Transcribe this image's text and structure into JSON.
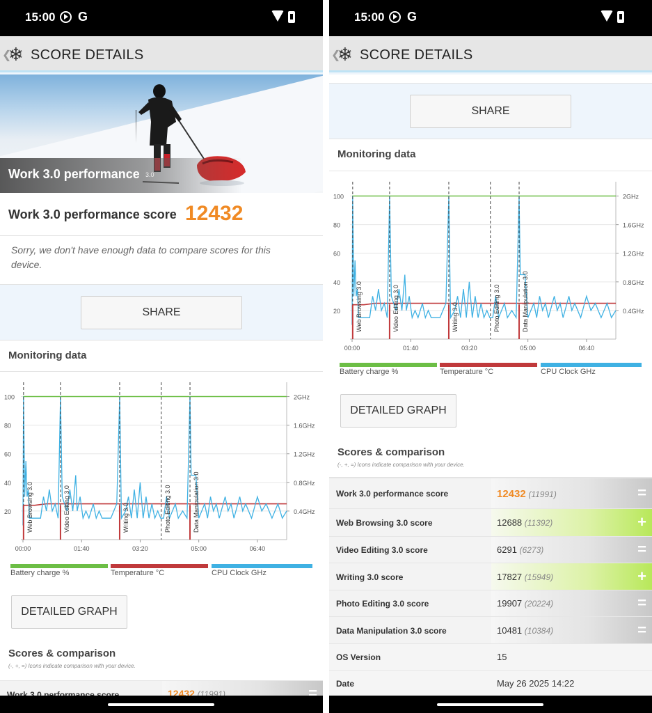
{
  "status": {
    "time": "15:00",
    "carrier_icon": "G"
  },
  "appbar": {
    "title": "SCORE DETAILS",
    "back_icon": "back-chevron",
    "logo_icon": "snowflake"
  },
  "hero": {
    "title": "Work 3.0 performance",
    "version": "3.0"
  },
  "score": {
    "label": "Work 3.0 performance score",
    "value": "12432"
  },
  "compare_note": "Sorry, we don't have enough data to compare scores for this device.",
  "share_label": "SHARE",
  "monitoring": {
    "title": "Monitoring data",
    "detailed_graph_label": "DETAILED GRAPH",
    "legend": [
      {
        "label": "Battery charge %",
        "color": "#6cbe45"
      },
      {
        "label": "Temperature °C",
        "color": "#c0393b"
      },
      {
        "label": "CPU Clock GHz",
        "color": "#3fb1e3"
      }
    ]
  },
  "chart_data": {
    "type": "line",
    "x_ticks": [
      "00:00",
      "01:40",
      "03:20",
      "05:00",
      "06:40"
    ],
    "y_left_ticks": [
      "100",
      "80",
      "60",
      "40",
      "20"
    ],
    "y_right_ticks": [
      "2GHz",
      "1.6GHz",
      "1.2GHz",
      "0.8GHz",
      "0.4GHz"
    ],
    "segments": [
      "Web Browsing 3.0",
      "Video Editing 3.0",
      "Writing 3.0",
      "Photo Editing 3.0",
      "Data Manipulation 3.0"
    ],
    "segment_starts_s": [
      2,
      128,
      330,
      472,
      570
    ],
    "x_max_s": 900,
    "ylim": [
      0,
      110
    ],
    "series": [
      {
        "name": "Battery charge %",
        "color": "#6cbe45",
        "points": [
          [
            0,
            100
          ],
          [
            900,
            100
          ]
        ]
      },
      {
        "name": "Temperature °C",
        "color": "#c0393b",
        "points": [
          [
            0,
            24
          ],
          [
            40,
            24
          ],
          [
            80,
            25
          ],
          [
            900,
            25
          ]
        ]
      },
      {
        "name": "CPU Clock GHz",
        "color": "#3fb1e3",
        "points": [
          [
            0,
            0.2
          ],
          [
            2,
            2.0
          ],
          [
            6,
            0.6
          ],
          [
            10,
            1.1
          ],
          [
            14,
            0.6
          ],
          [
            18,
            0.7
          ],
          [
            22,
            0.3
          ],
          [
            40,
            0.3
          ],
          [
            60,
            0.3
          ],
          [
            70,
            0.6
          ],
          [
            80,
            0.4
          ],
          [
            90,
            0.7
          ],
          [
            100,
            0.4
          ],
          [
            110,
            0.5
          ],
          [
            120,
            0.3
          ],
          [
            128,
            2.0
          ],
          [
            134,
            0.6
          ],
          [
            150,
            0.4
          ],
          [
            160,
            0.7
          ],
          [
            170,
            0.4
          ],
          [
            180,
            0.9
          ],
          [
            185,
            0.4
          ],
          [
            195,
            0.6
          ],
          [
            205,
            0.3
          ],
          [
            215,
            0.4
          ],
          [
            225,
            0.3
          ],
          [
            240,
            0.5
          ],
          [
            250,
            0.3
          ],
          [
            260,
            0.4
          ],
          [
            270,
            0.3
          ],
          [
            300,
            0.3
          ],
          [
            310,
            0.4
          ],
          [
            320,
            0.5
          ],
          [
            330,
            2.0
          ],
          [
            336,
            0.3
          ],
          [
            350,
            0.4
          ],
          [
            360,
            0.6
          ],
          [
            370,
            0.3
          ],
          [
            380,
            0.7
          ],
          [
            390,
            0.3
          ],
          [
            400,
            0.8
          ],
          [
            410,
            0.3
          ],
          [
            420,
            0.6
          ],
          [
            430,
            0.3
          ],
          [
            440,
            0.5
          ],
          [
            450,
            0.3
          ],
          [
            460,
            0.4
          ],
          [
            470,
            0.3
          ],
          [
            480,
            0.3
          ],
          [
            490,
            0.6
          ],
          [
            500,
            0.3
          ],
          [
            510,
            0.4
          ],
          [
            520,
            0.5
          ],
          [
            530,
            0.3
          ],
          [
            545,
            0.4
          ],
          [
            560,
            0.3
          ],
          [
            570,
            2.0
          ],
          [
            574,
            0.9
          ],
          [
            590,
            0.9
          ],
          [
            600,
            0.3
          ],
          [
            620,
            0.5
          ],
          [
            630,
            0.3
          ],
          [
            640,
            0.6
          ],
          [
            650,
            0.4
          ],
          [
            660,
            0.5
          ],
          [
            670,
            0.3
          ],
          [
            690,
            0.6
          ],
          [
            700,
            0.4
          ],
          [
            710,
            0.5
          ],
          [
            720,
            0.3
          ],
          [
            740,
            0.6
          ],
          [
            750,
            0.4
          ],
          [
            760,
            0.5
          ],
          [
            780,
            0.3
          ],
          [
            800,
            0.6
          ],
          [
            815,
            0.4
          ],
          [
            830,
            0.5
          ],
          [
            850,
            0.3
          ],
          [
            870,
            0.5
          ],
          [
            885,
            0.3
          ],
          [
            900,
            0.4
          ]
        ]
      }
    ]
  },
  "scores": {
    "title": "Scores & comparison",
    "note": "(-, +, =) Icons indicate comparison with your device.",
    "rows": [
      {
        "label": "Work 3.0 performance score",
        "value": "12432",
        "compare": "(11991)",
        "symbol": "=",
        "highlight": "grey",
        "accent": true
      },
      {
        "label": "Web Browsing 3.0 score",
        "value": "12688",
        "compare": "(11392)",
        "symbol": "+",
        "highlight": "green"
      },
      {
        "label": "Video Editing 3.0 score",
        "value": "6291",
        "compare": "(6273)",
        "symbol": "=",
        "highlight": "grey"
      },
      {
        "label": "Writing 3.0 score",
        "value": "17827",
        "compare": "(15949)",
        "symbol": "+",
        "highlight": "green"
      },
      {
        "label": "Photo Editing 3.0 score",
        "value": "19907",
        "compare": "(20224)",
        "symbol": "=",
        "highlight": "grey"
      },
      {
        "label": "Data Manipulation 3.0 score",
        "value": "10481",
        "compare": "(10384)",
        "symbol": "=",
        "highlight": "grey"
      },
      {
        "label": "OS Version",
        "value": "15",
        "compare": "",
        "symbol": "",
        "highlight": "none"
      },
      {
        "label": "Date",
        "value": "May 26 2025 14:22",
        "compare": "",
        "symbol": "",
        "highlight": "none"
      }
    ]
  },
  "colors": {
    "accent_orange": "#f08a24",
    "appbar_bg": "#e6e6e6",
    "page_bg": "#eef5fc"
  }
}
